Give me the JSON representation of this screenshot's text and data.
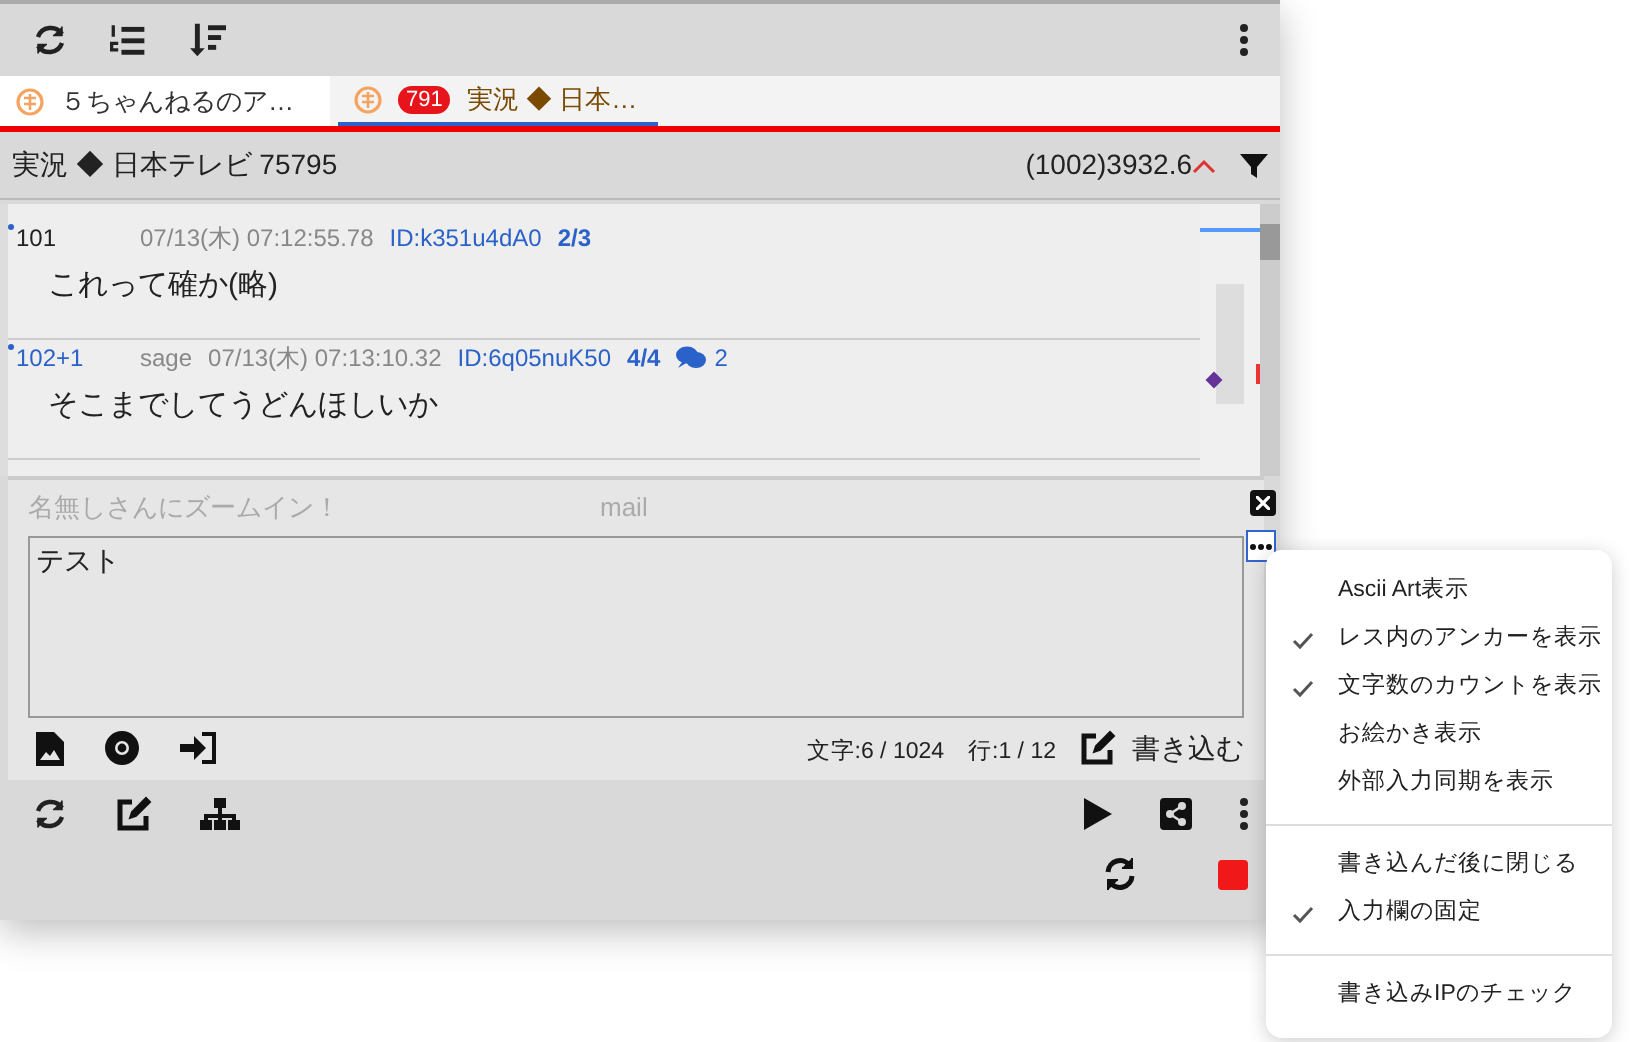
{
  "tabs": [
    {
      "label": "５ちゃんねるのア…",
      "selected": false
    },
    {
      "label": "実況 ◆ 日本…",
      "badge": "791",
      "selected": true
    }
  ],
  "thread_header": {
    "title": "実況 ◆ 日本テレビ 75795",
    "stats": "(1002)3932.6"
  },
  "posts": [
    {
      "number": "101",
      "date": "07/13(木) 07:12:55.78",
      "id": "ID:k351u4dA0",
      "count": "2/3",
      "body": "これって確か(略)"
    },
    {
      "number": "102+1",
      "mail": "sage",
      "date": "07/13(木) 07:13:10.32",
      "id": "ID:6q05nuK50",
      "count": "4/4",
      "replies": "2",
      "body": "そこまでしてうどんほしいか"
    }
  ],
  "compose": {
    "name_placeholder": "名無しさんにズームイン！",
    "mail_placeholder": "mail",
    "message": "テスト",
    "counter": "文字:6 / 1024　行:1 / 12",
    "submit": "書き込む"
  },
  "menu": {
    "groups": [
      [
        {
          "label": "Ascii Art表示",
          "checked": false
        },
        {
          "label": "レス内のアンカーを表示",
          "checked": true
        },
        {
          "label": "文字数のカウントを表示",
          "checked": true
        },
        {
          "label": "お絵かき表示",
          "checked": false
        },
        {
          "label": "外部入力同期を表示",
          "checked": false
        }
      ],
      [
        {
          "label": "書き込んだ後に閉じる",
          "checked": false
        },
        {
          "label": "入力欄の固定",
          "checked": true
        }
      ],
      [
        {
          "label": "書き込みIPのチェック",
          "checked": false
        }
      ]
    ]
  }
}
